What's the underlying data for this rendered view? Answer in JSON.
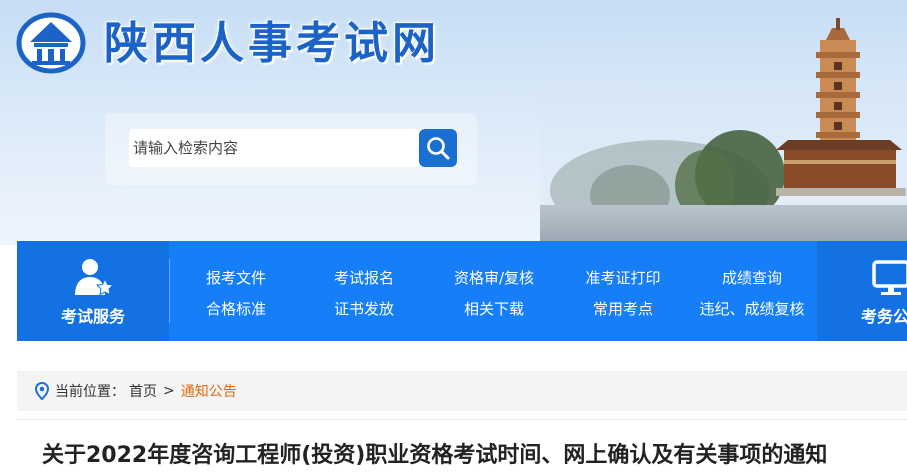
{
  "site": {
    "title": "陕西人事考试网"
  },
  "search": {
    "placeholder": "请输入检索内容"
  },
  "nav": {
    "left_label": "考试服务",
    "right_label": "考务公",
    "links": [
      {
        "label": "报考文件"
      },
      {
        "label": "考试报名"
      },
      {
        "label": "资格审/复核"
      },
      {
        "label": "准考证打印"
      },
      {
        "label": "成绩查询"
      },
      {
        "label": "合格标准"
      },
      {
        "label": "证书发放"
      },
      {
        "label": "相关下载"
      },
      {
        "label": "常用考点"
      },
      {
        "label": "违纪、成绩复核"
      }
    ]
  },
  "breadcrumb": {
    "prefix": "当前位置：",
    "home": "首页",
    "separator": ">",
    "current": "通知公告"
  },
  "article": {
    "title": "关于2022年度咨询工程师(投资)职业资格考试时间、网上确认及有关事项的通知"
  },
  "colors": {
    "brand_blue": "#1b63c6",
    "nav_blue": "#167ff7",
    "nav_dark": "#1371e4",
    "breadcrumb_current": "#e06a10"
  },
  "icons": [
    "emblem-logo",
    "search-icon",
    "person-star-icon",
    "monitor-icon",
    "location-pin-icon"
  ]
}
